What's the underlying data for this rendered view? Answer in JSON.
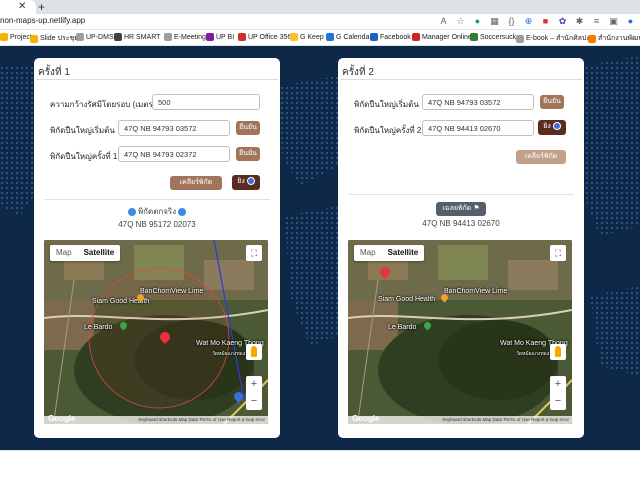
{
  "browser": {
    "url": "non-maps-up.netlify.app",
    "bookmarks": [
      "Project",
      "Slide ประชุม",
      "UP-DMS",
      "HR SMART",
      "E-Meeting",
      "UP BI",
      "UP Office 356",
      "G Keep",
      "G Calendar",
      "Facebook",
      "Manager Online",
      "Soccersuck",
      "E-book – สำนักศิลปะฯ",
      "สำนักงานพัฒนาฯ FB"
    ]
  },
  "colors": {
    "page_bg": "#0e2847",
    "button_brown": "#a0755c",
    "button_dark": "#5a2b1f",
    "button_slate": "#555f6b"
  },
  "card1": {
    "title": "ครั้งที่ 1",
    "radius_label": "ความกว้างรัศมีโดยรอบ (เมตร)",
    "radius_value": "500",
    "start_label": "พิกัดปืนใหญ่เริ่มต้น",
    "start_value": "47Q NB 94793 03572",
    "start_btn": "ยืนยัน",
    "fire1_label": "พิกัดปืนใหญ่ครั้งที่ 1",
    "fire1_value": "47Q NB 94793 02372",
    "fire1_btn": "ยืนยัน",
    "clear_btn": "เคลียร์พิกัด",
    "fire_btn": "ยิง",
    "result_label": "พิกัดตกจริง",
    "result_value": "47Q NB 95172 02073"
  },
  "card2": {
    "title": "ครั้งที่ 2",
    "start_label": "พิกัดปืนใหญ่เริ่มต้น",
    "start_value": "47Q NB 94793 03572",
    "start_btn": "ยืนยัน",
    "fire2_label": "พิกัดปืนใหญ่ครั้งที่ 2",
    "fire2_value": "47Q NB 94413 02670",
    "fire_btn": "ยิง",
    "clear_btn": "เคลียร์พิกัด",
    "result_btn": "เฉลยพิกัด",
    "result_value": "47Q NB 94413 02670"
  },
  "map": {
    "tab_map": "Map",
    "tab_satellite": "Satellite",
    "label_banchom": "BanChomView Lime",
    "label_siam": "Siam Good Health",
    "label_lebardo": "Le Bardo",
    "label_wat": "Wat Mo Kaeng Thong",
    "label_wat_sub": "วัดหม้อแกงทอง",
    "google": "Google",
    "footer": "Keyboard shortcuts  Map Data  Terms of Use  Report a map error"
  }
}
